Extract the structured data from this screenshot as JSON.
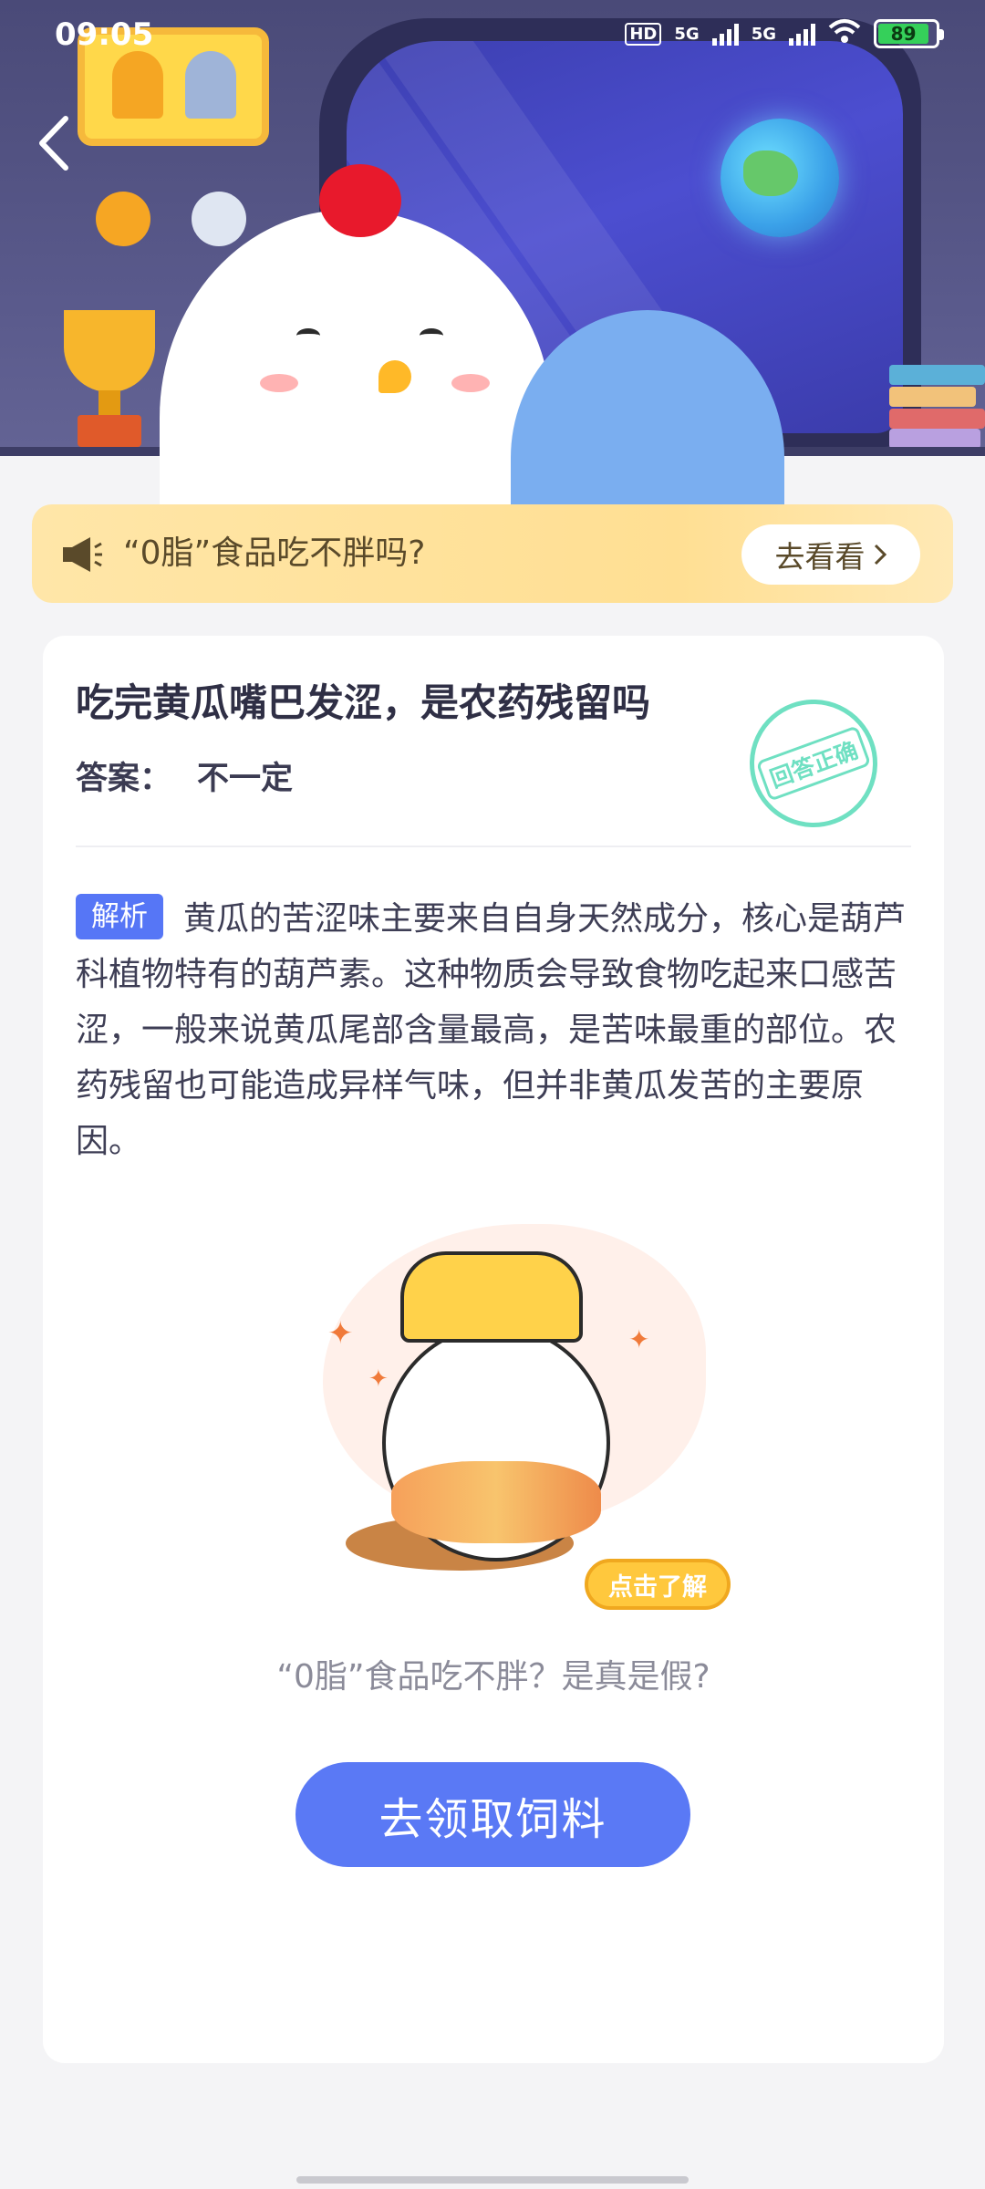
{
  "status_bar": {
    "time": "09:05",
    "network_1": "5G",
    "network_2": "5G",
    "hd_label": "HD",
    "battery_level": "89",
    "battery_color": "#35d05a"
  },
  "icons": {
    "back": "chevron-left-icon",
    "notice": "megaphone-icon",
    "notice_arrow": "chevron-right-icon"
  },
  "notice": {
    "text": "“0脂”食品吃不胖吗?",
    "button": "去看看"
  },
  "question": {
    "title": "吃完黄瓜嘴巴发涩，是农药残留吗",
    "answer_label": "答案：",
    "answer_value": "不一定",
    "stamp_text": "回答正确"
  },
  "analysis": {
    "tag": "解析",
    "text": "黄瓜的苦涩味主要来自自身天然成分，核心是葫芦科植物特有的葫芦素。这种物质会导致食物吃起来口感苦涩，一般来说黄瓜尾部含量最高，是苦味最重的部位。农药残留也可能造成异样气味，但并非黄瓜发苦的主要原因。"
  },
  "promo": {
    "learn_more": "点击了解",
    "caption": "“0脂”食品吃不胖？是真是假?",
    "action_button": "去领取饲料"
  },
  "colors": {
    "accent_blue": "#5a79f5",
    "notice_bg": "#ffdf93",
    "correct_green": "#6fe0c2"
  }
}
